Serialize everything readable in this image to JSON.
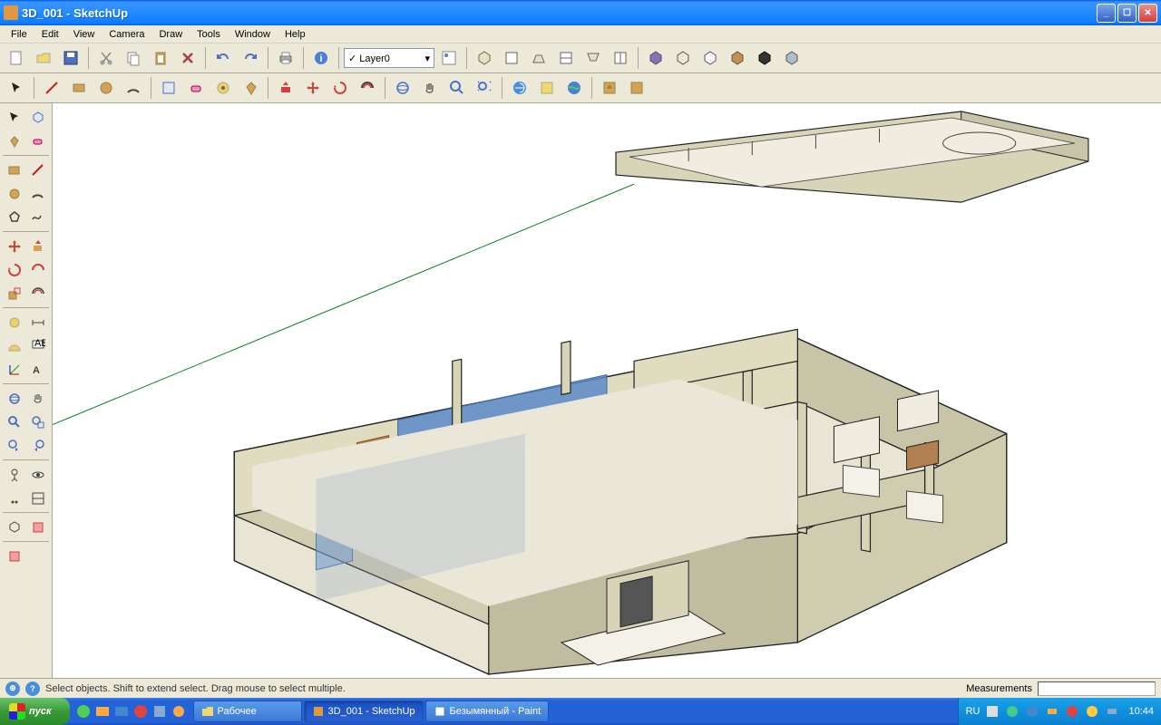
{
  "titlebar": {
    "text": "3D_001 - SketchUp"
  },
  "menubar": [
    "File",
    "Edit",
    "View",
    "Camera",
    "Draw",
    "Tools",
    "Window",
    "Help"
  ],
  "layer_select": "Layer0",
  "statusbar": {
    "hint": "Select objects. Shift to extend select. Drag mouse to select multiple.",
    "measurements_label": "Measurements"
  },
  "taskbar": {
    "start": "пуск",
    "tasks": [
      {
        "label": "Рабочее",
        "active": false
      },
      {
        "label": "3D_001 - SketchUp",
        "active": true
      },
      {
        "label": "Безымянный - Paint",
        "active": false
      }
    ],
    "lang": "RU",
    "time": "10:44"
  }
}
